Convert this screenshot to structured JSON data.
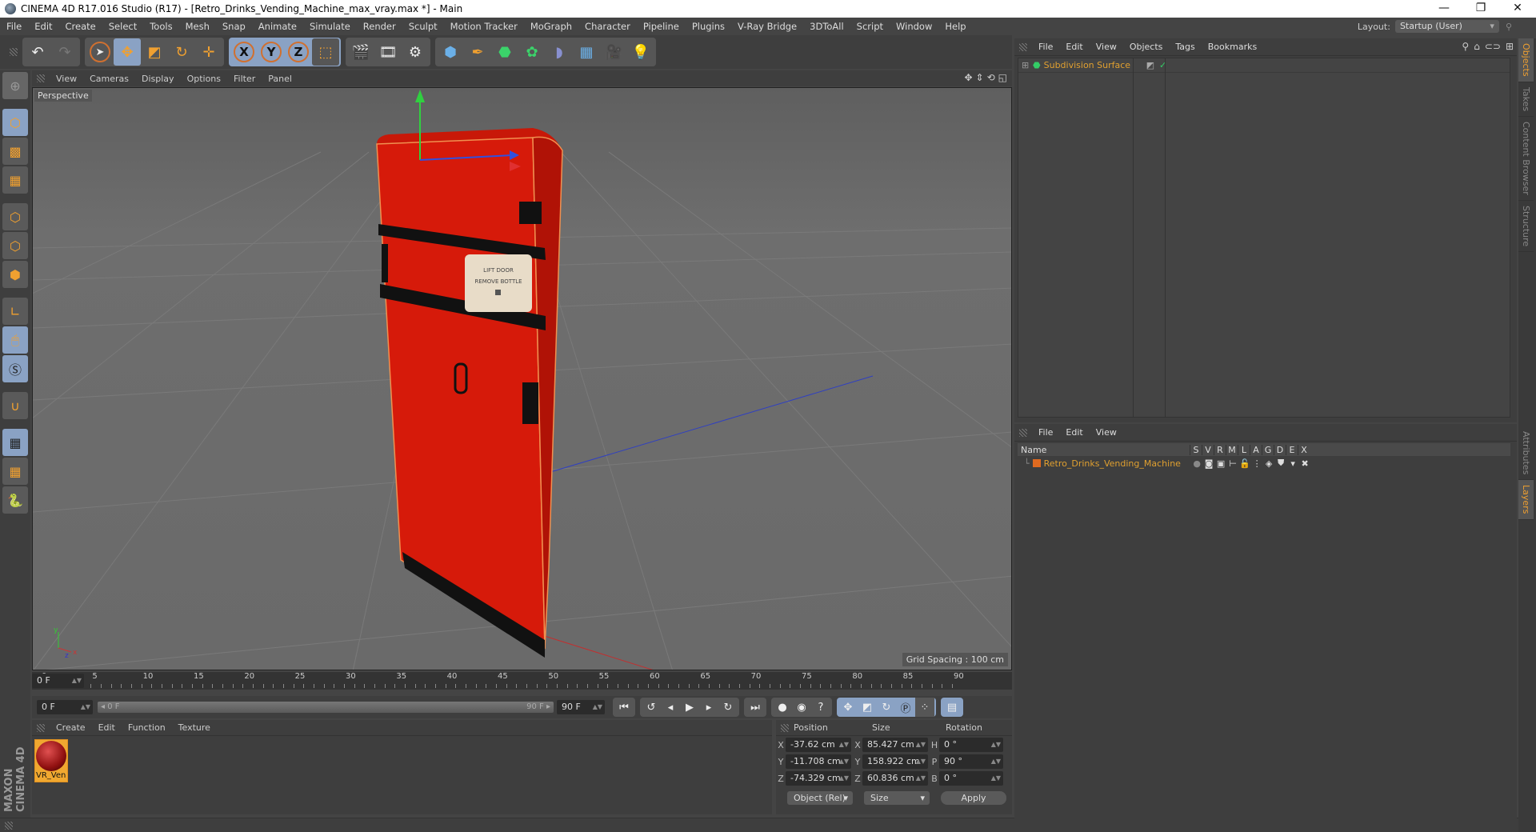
{
  "window": {
    "title": "CINEMA 4D R17.016 Studio (R17) - [Retro_Drinks_Vending_Machine_max_vray.max *] - Main",
    "controls": {
      "minimize": "—",
      "restore": "❐",
      "close": "✕"
    }
  },
  "menubar": {
    "items": [
      "File",
      "Edit",
      "Create",
      "Select",
      "Tools",
      "Mesh",
      "Snap",
      "Animate",
      "Simulate",
      "Render",
      "Sculpt",
      "Motion Tracker",
      "MoGraph",
      "Character",
      "Pipeline",
      "Plugins",
      "V-Ray Bridge",
      "3DToAll",
      "Script",
      "Window",
      "Help"
    ],
    "layout_label": "Layout:",
    "layout_value": "Startup (User)"
  },
  "toolbar": {
    "undo": "undo-icon",
    "redo": "redo-icon",
    "tools": [
      "select-icon",
      "move-icon",
      "scale-icon",
      "rotate-icon",
      "live-transform-icon"
    ],
    "axes": [
      "X",
      "Y",
      "Z"
    ],
    "coord_system": "world-coordinate-icon",
    "render": [
      "render-view-icon",
      "render-picture-viewer-icon",
      "render-settings-icon"
    ],
    "objects": [
      "cube-icon",
      "pen-icon",
      "subdivision-icon",
      "cloner-icon",
      "deformer-icon",
      "floor-icon",
      "camera-icon",
      "light-icon"
    ]
  },
  "left_tools": [
    "make-editable-icon",
    "model-mode-icon",
    "texture-mode-icon",
    "workplane-icon",
    "points-mode-icon",
    "edges-mode-icon",
    "polygons-mode-icon",
    "axis-icon",
    "tweak-icon",
    "soft-selection-icon",
    "snap-magnet-icon",
    "lock-workplane-icon",
    "planar-workplane-icon",
    "python-icon"
  ],
  "viewport": {
    "menu": [
      "View",
      "Cameras",
      "Display",
      "Options",
      "Filter",
      "Panel"
    ],
    "camera_label": "Perspective",
    "grid_spacing": "Grid Spacing : 100 cm",
    "model_label_line1": "LIFT DOOR",
    "model_label_line2": "REMOVE BOTTLE"
  },
  "timeline": {
    "ticks": [
      "0",
      "5",
      "10",
      "15",
      "20",
      "25",
      "30",
      "35",
      "40",
      "45",
      "50",
      "55",
      "60",
      "65",
      "70",
      "75",
      "80",
      "85",
      "90"
    ],
    "current_frame": "0 F",
    "start_field": "0 F",
    "range_start": "0 F",
    "range_end": "90 F",
    "end_field": "90 F"
  },
  "material_manager": {
    "menu": [
      "Create",
      "Edit",
      "Function",
      "Texture"
    ],
    "materials": [
      {
        "name": "VR_Ven"
      }
    ]
  },
  "coordinates": {
    "headers": [
      "Position",
      "Size",
      "Rotation"
    ],
    "rows": [
      {
        "pos_axis": "X",
        "pos": "-37.62 cm",
        "size_axis": "X",
        "size": "85.427 cm",
        "rot_axis": "H",
        "rot": "0 °"
      },
      {
        "pos_axis": "Y",
        "pos": "-11.708 cm",
        "size_axis": "Y",
        "size": "158.922 cm",
        "rot_axis": "P",
        "rot": "90 °"
      },
      {
        "pos_axis": "Z",
        "pos": "-74.329 cm",
        "size_axis": "Z",
        "size": "60.836 cm",
        "rot_axis": "B",
        "rot": "0 °"
      }
    ],
    "mode": "Object (Rel)",
    "size_mode": "Size",
    "apply": "Apply"
  },
  "object_manager": {
    "menu": [
      "File",
      "Edit",
      "View",
      "Objects",
      "Tags",
      "Bookmarks"
    ],
    "objects": [
      {
        "name": "Subdivision Surface",
        "check": "✓"
      }
    ]
  },
  "layer_manager": {
    "menu": [
      "File",
      "Edit",
      "View"
    ],
    "columns": [
      "Name",
      "S",
      "V",
      "R",
      "M",
      "L",
      "A",
      "G",
      "D",
      "E",
      "X"
    ],
    "layers": [
      {
        "name": "Retro_Drinks_Vending_Machine",
        "color": "#e06a20"
      }
    ]
  },
  "side_tabs": {
    "top": [
      "Objects",
      "Takes",
      "Content Browser",
      "Structure"
    ],
    "bottom": [
      "Attributes",
      "Layers"
    ]
  },
  "branding": "MAXON CINEMA 4D",
  "colors": {
    "accent": "#f0a030",
    "selected_tool": "#8aa2c4",
    "model_red": "#d81a0a"
  }
}
